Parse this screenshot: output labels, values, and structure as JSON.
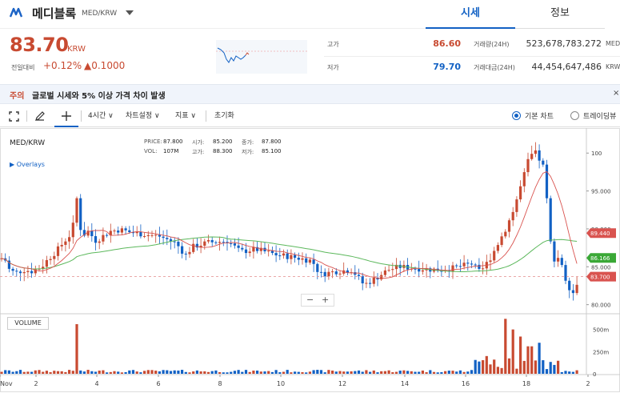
{
  "header": {
    "coin_name": "메디블록",
    "pair": "MED/KRW",
    "tabs": [
      {
        "label": "시세",
        "active": true
      },
      {
        "label": "정보",
        "active": false
      }
    ]
  },
  "ticker": {
    "price": "83.70",
    "unit": "KRW",
    "change_label": "전일대비",
    "change_rate": "+0.12%",
    "change_amount": "▲0.1000",
    "high_label": "고가",
    "high": "86.60",
    "low_label": "저가",
    "low": "79.70",
    "volume_label": "거래량(24H)",
    "volume": "523,678,783.272",
    "volume_unit": "MED",
    "turnover_label": "거래대금(24H)",
    "turnover": "44,454,647,486",
    "turnover_unit": "KRW"
  },
  "notice": {
    "tag": "주의",
    "text": "글로벌 시세와 5% 이상 가격 차이 발생",
    "close": "×"
  },
  "toolbar": {
    "interval": "4시간",
    "chart_settings": "차트설정",
    "indicators": "지표",
    "reset": "초기화",
    "basic_chart": "기본 차트",
    "tradingview": "트레이딩뷰"
  },
  "legend": {
    "pair": "MED/KRW",
    "overlays": "Overlays",
    "price_label": "PRICE:",
    "price": "87.800",
    "open_label": "시가:",
    "open": "85.200",
    "close_label": "종가:",
    "close": "87.800",
    "vol_label": "VOL:",
    "vol": "107M",
    "high_label": "고가:",
    "high": "88.300",
    "low_label": "저가:",
    "low": "85.100",
    "volume_pane": "VOLUME",
    "zoom_out": "−",
    "zoom_in": "+"
  },
  "colors": {
    "up": "#c84a31",
    "down": "#1261c4",
    "ma_short": "#d9534f",
    "ma_long": "#5cb85c"
  },
  "chart_data": {
    "type": "candlestick",
    "price_ticks": [
      "100",
      "95.000",
      "90.000",
      "85.000",
      "80.000"
    ],
    "price_ylim": [
      78.8,
      103.3
    ],
    "volume_ticks": [
      "500m",
      "250m",
      "0"
    ],
    "volume_ylim": [
      0,
      650
    ],
    "x_ticks": [
      "Nov",
      "2",
      "4",
      "6",
      "8",
      "10",
      "12",
      "14",
      "16",
      "18",
      "2"
    ],
    "badges": [
      {
        "label": "89.440",
        "value": 89.44,
        "color": "#d9534f"
      },
      {
        "label": "86.166",
        "value": 86.166,
        "color": "#3aa836"
      },
      {
        "label": "83.700",
        "value": 83.7,
        "color": "#d9534f"
      }
    ],
    "current_price": 83.7
  }
}
